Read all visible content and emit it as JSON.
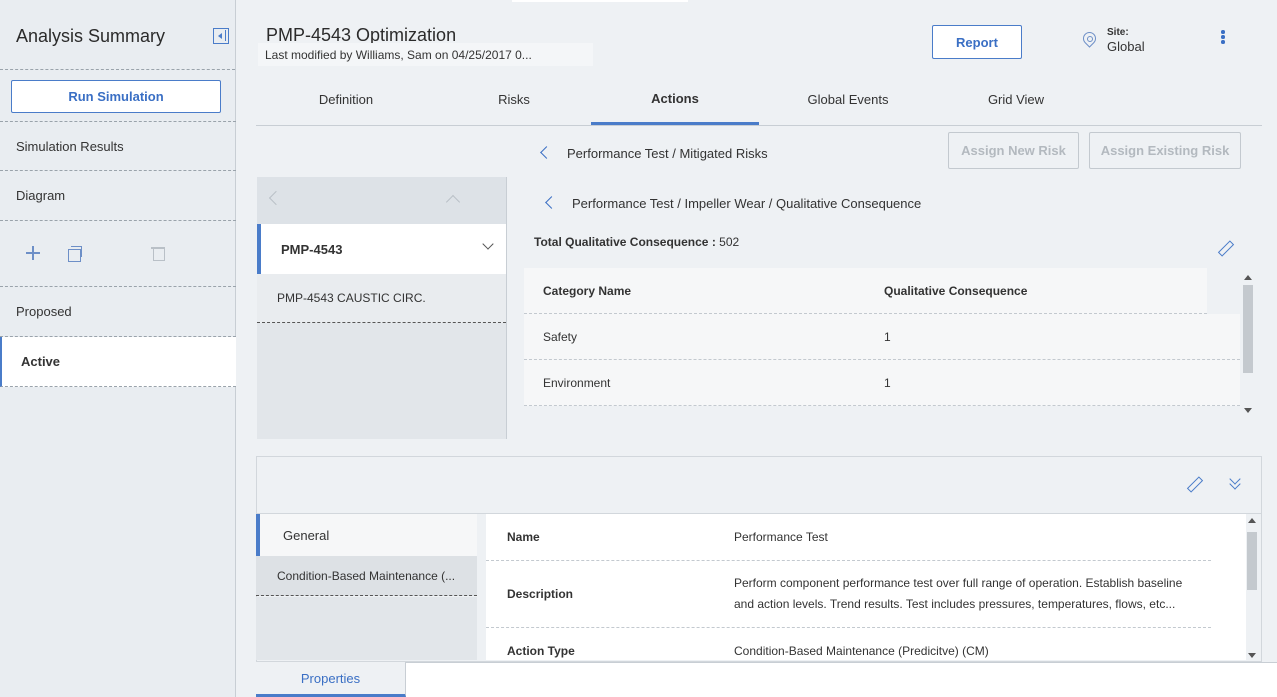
{
  "sidebar": {
    "title": "Analysis Summary",
    "run_button": "Run Simulation",
    "items": [
      "Simulation Results",
      "Diagram"
    ],
    "sections": [
      "Proposed",
      "Active"
    ]
  },
  "header": {
    "title": "PMP-4543 Optimization",
    "modified": "Last modified by Williams, Sam on 04/25/2017 0...",
    "report_button": "Report",
    "site_label": "Site:",
    "site_value": "Global"
  },
  "tabs": [
    "Definition",
    "Risks",
    "Actions",
    "Global Events",
    "Grid View"
  ],
  "nav": {
    "item": "PMP-4543",
    "sub": "PMP-4543 CAUSTIC CIRC."
  },
  "breadcrumbs": {
    "level1": "Performance Test / Mitigated Risks",
    "level2": "Performance Test / Impeller Wear / Qualitative Consequence"
  },
  "buttons": {
    "assign_new": "Assign New Risk",
    "assign_existing": "Assign Existing Risk"
  },
  "total": {
    "label": "Total Qualitative Consequence :",
    "value": "502"
  },
  "table": {
    "headers": [
      "Category Name",
      "Qualitative Consequence"
    ],
    "rows": [
      [
        "Safety",
        "1"
      ],
      [
        "Environment",
        "1"
      ]
    ]
  },
  "detail": {
    "sections": [
      "General",
      "Condition-Based Maintenance (..."
    ],
    "properties": [
      {
        "key": "Name",
        "value": "Performance Test"
      },
      {
        "key": "Description",
        "value": "Perform component performance test over full range of operation. Establish baseline and action levels. Trend results. Test includes pressures, temperatures, flows, etc..."
      },
      {
        "key": "Action Type",
        "value": "Condition-Based Maintenance (Predicitve) (CM)"
      }
    ],
    "bottom_tab": "Properties"
  }
}
